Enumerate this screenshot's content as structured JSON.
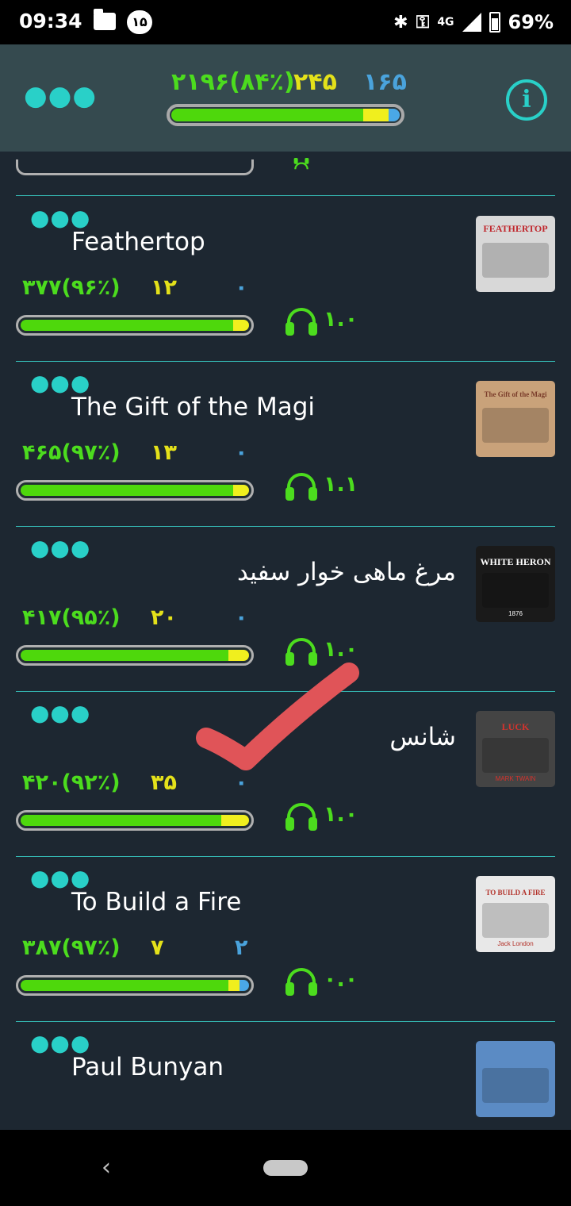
{
  "status_bar": {
    "time": "09:34",
    "badge": "۱۵",
    "network": "4G",
    "battery": "69%"
  },
  "header": {
    "stats": {
      "green": "۲۱۹۶(۸۴٪)",
      "yellow": "۲۴۵",
      "blue": "۱۶۵"
    },
    "progress": {
      "green": 0.84,
      "yellow": 0.11,
      "blue": 0.05
    },
    "info_label": "i"
  },
  "books": [
    {
      "title": "Feathertop",
      "rtl": false,
      "green": "۳۷۷(۹۶٪)",
      "yellow": "۱۲",
      "blue": "۰",
      "audio": "۱.۰",
      "progress": {
        "green": 0.93,
        "yellow": 0.07,
        "blue": 0.0
      },
      "cover": {
        "label": "FEATHERTOP",
        "bg": "#d8d8d8",
        "fg": "#c0272d"
      }
    },
    {
      "title": "The Gift of the Magi",
      "rtl": false,
      "green": "۴۶۵(۹۷٪)",
      "yellow": "۱۳",
      "blue": "۰",
      "audio": "۱.۱",
      "progress": {
        "green": 0.93,
        "yellow": 0.07,
        "blue": 0.0
      },
      "cover": {
        "label": "The Gift of the Magi",
        "bg": "#c9a27a",
        "fg": "#7a3c2a"
      }
    },
    {
      "title": "مرغ ماهی خوار سفید",
      "rtl": true,
      "green": "۴۱۷(۹۵٪)",
      "yellow": "۲۰",
      "blue": "۰",
      "audio": "۱.۰",
      "progress": {
        "green": 0.91,
        "yellow": 0.09,
        "blue": 0.0
      },
      "cover": {
        "label": "WHITE HERON",
        "sub": "1876",
        "bg": "#1a1a1a",
        "fg": "#ffffff"
      }
    },
    {
      "title": "شانس",
      "rtl": true,
      "green": "۴۲۰(۹۲٪)",
      "yellow": "۳۵",
      "blue": "۰",
      "audio": "۱.۰",
      "progress": {
        "green": 0.88,
        "yellow": 0.12,
        "blue": 0.0
      },
      "cover": {
        "label": "LUCK",
        "sub": "MARK TWAIN",
        "bg": "#444444",
        "fg": "#d6332d"
      }
    },
    {
      "title": "To Build a Fire",
      "rtl": false,
      "green": "۳۸۷(۹۷٪)",
      "yellow": "۷",
      "blue": "۲",
      "audio": "۰.۰",
      "progress": {
        "green": 0.91,
        "yellow": 0.05,
        "blue": 0.04
      },
      "cover": {
        "label": "TO BUILD A FIRE",
        "sub": "Jack London",
        "bg": "#e8e8e8",
        "fg": "#b3322a"
      }
    },
    {
      "title": "Paul Bunyan",
      "rtl": false,
      "cover": {
        "bg": "#5b8bc4",
        "fg": "#ffffff"
      }
    }
  ],
  "colors": {
    "accent": "#29d0c8",
    "green": "#4cdc1e",
    "yellow": "#e4e11a",
    "blue": "#4aa3dc"
  }
}
